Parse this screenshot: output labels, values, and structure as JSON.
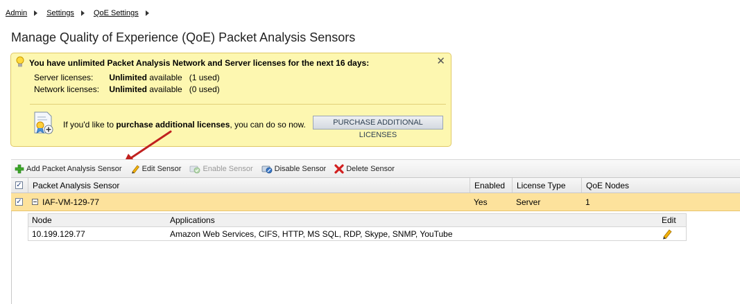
{
  "breadcrumb": {
    "items": [
      "Admin",
      "Settings",
      "QoE Settings"
    ]
  },
  "page": {
    "title": "Manage Quality of Experience (QoE) Packet Analysis Sensors"
  },
  "notice": {
    "headline": "You have unlimited Packet Analysis Network and Server licenses for the next 16 days:",
    "close_label": "✕",
    "server": {
      "label": "Server licenses:",
      "amount": "Unlimited",
      "available": "available",
      "used": "(1 used)"
    },
    "network": {
      "label": "Network licenses:",
      "amount": "Unlimited",
      "available": "available",
      "used": "(0 used)"
    },
    "purchase_prefix": "If you'd like to",
    "purchase_bold": "purchase additional licenses",
    "purchase_suffix": ", you can do so now.",
    "purchase_button": "PURCHASE ADDITIONAL LICENSES"
  },
  "toolbar": {
    "add": "Add Packet Analysis Sensor",
    "edit": "Edit Sensor",
    "enable": "Enable Sensor",
    "disable": "Disable Sensor",
    "delete": "Delete Sensor"
  },
  "grid": {
    "columns": {
      "sensor": "Packet Analysis Sensor",
      "enabled": "Enabled",
      "license": "License Type",
      "nodes": "QoE Nodes"
    },
    "header_check": "✓",
    "rows": [
      {
        "check": "✓",
        "name": "IAF-VM-129-77",
        "enabled": "Yes",
        "license": "Server",
        "nodes": "1"
      }
    ],
    "detail": {
      "columns": {
        "node": "Node",
        "applications": "Applications",
        "edit": "Edit"
      },
      "rows": [
        {
          "node": "10.199.129.77",
          "applications": "Amazon Web Services, CIFS, HTTP, MS SQL, RDP, Skype, SNMP, YouTube"
        }
      ]
    }
  },
  "colors": {
    "notice_bg": "#fdf7b0",
    "selected_row": "#fde29c",
    "annotation_arrow": "#c0211f"
  }
}
